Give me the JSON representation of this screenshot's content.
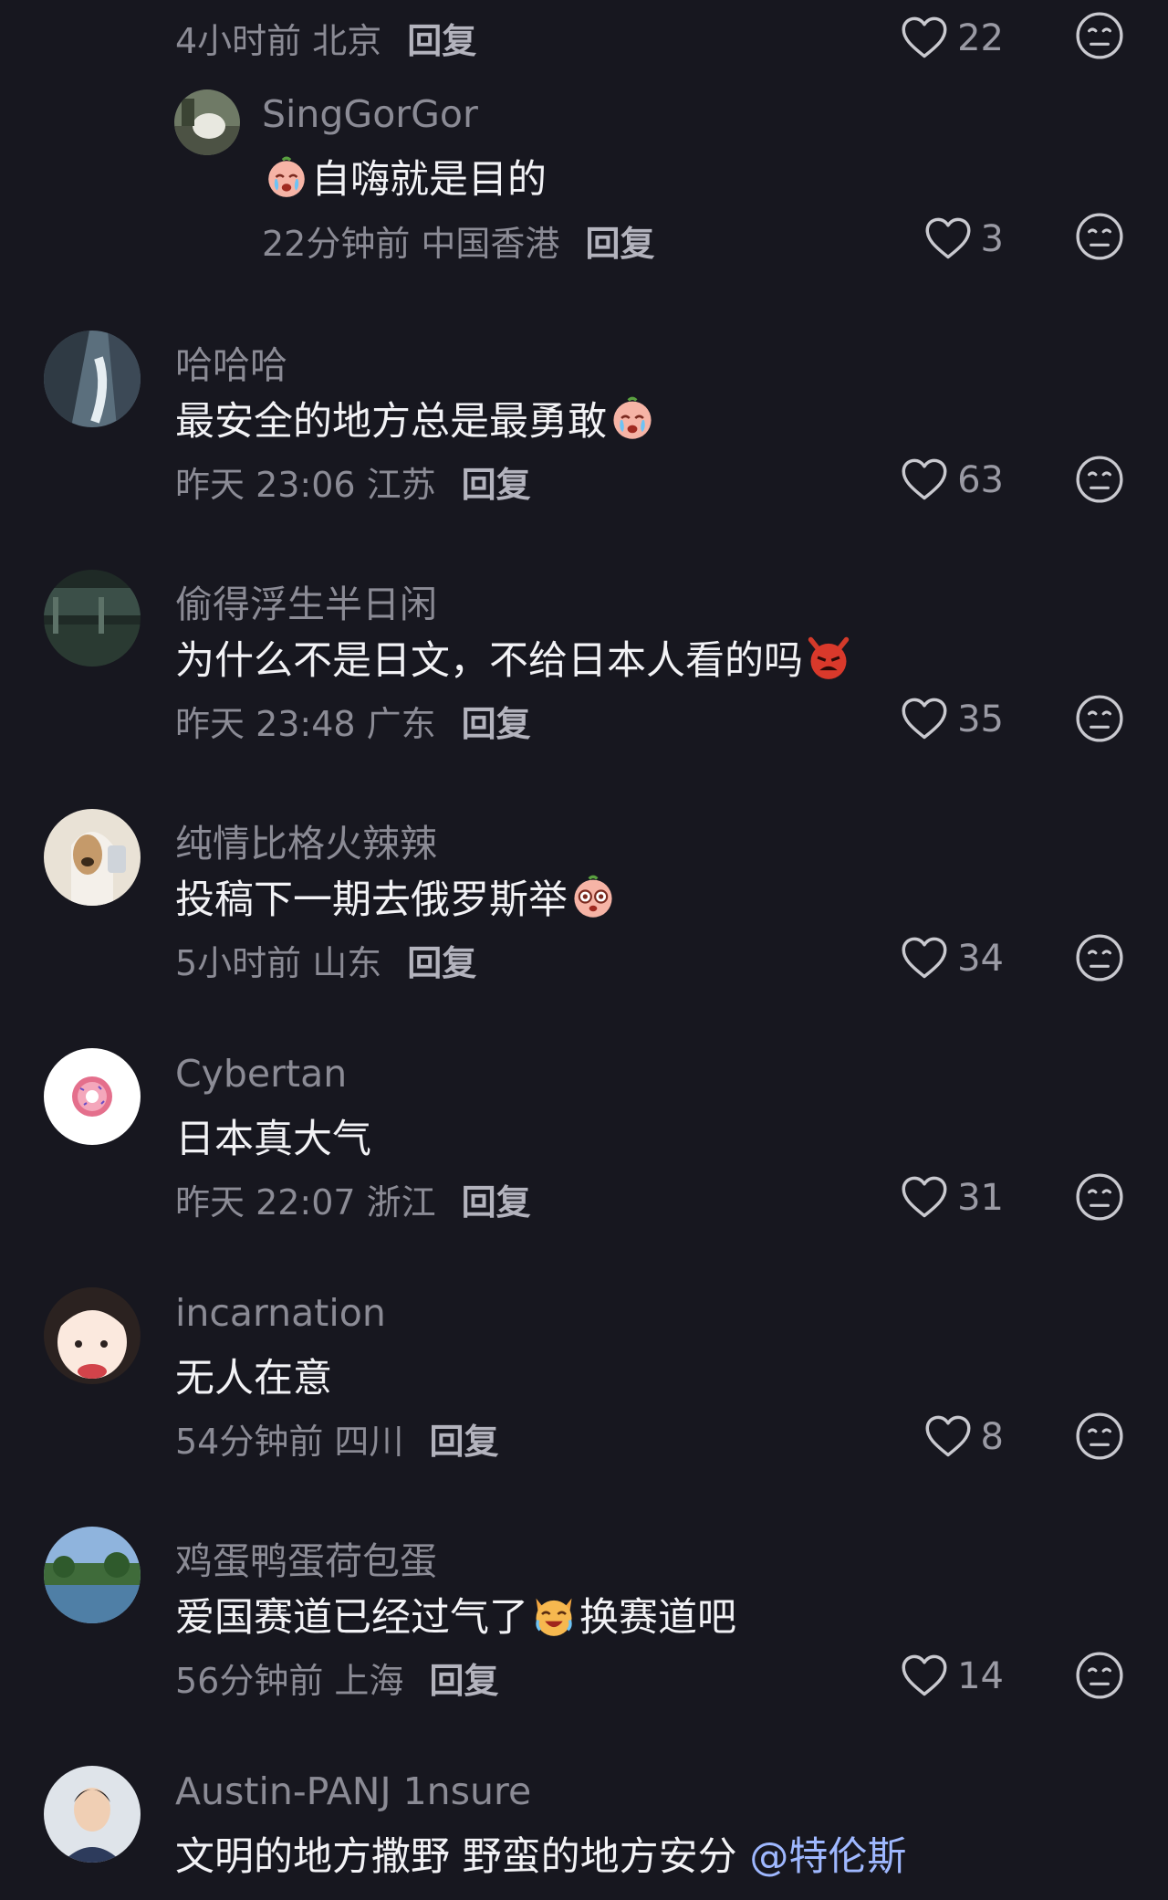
{
  "reply_label": "回复",
  "colors": {
    "background": "#17171f",
    "secondary_text": "#8b8b95",
    "primary_text": "#f2f2f5",
    "mention": "#9fb8ff"
  },
  "top_partial": {
    "meta": "4小时前 北京",
    "likes": "22"
  },
  "sub_reply": {
    "name": "SingGorGor",
    "text": "自嗨就是目的",
    "emoji": "crying-face",
    "meta": "22分钟前 中国香港",
    "likes": "3"
  },
  "comments": [
    {
      "name": "哈哈哈",
      "text": "最安全的地方总是最勇敢",
      "emoji": "crying-face",
      "meta": "昨天 23:06 江苏",
      "likes": "63"
    },
    {
      "name": "偷得浮生半日闲",
      "text": "为什么不是日文，不给日本人看的吗",
      "emoji": "angry-devil",
      "meta": "昨天 23:48 广东",
      "likes": "35"
    },
    {
      "name": "纯情比格火辣辣",
      "text": "投稿下一期去俄罗斯举",
      "emoji": "shocked-face",
      "meta": "5小时前 山东",
      "likes": "34"
    },
    {
      "name": "Cybertan",
      "text": "日本真大气",
      "meta": "昨天 22:07 浙江",
      "likes": "31"
    },
    {
      "name": "incarnation",
      "text": "无人在意",
      "meta": "54分钟前 四川",
      "likes": "8"
    },
    {
      "name": "鸡蛋鸭蛋荷包蛋",
      "text_before": "爱国赛道已经过气了",
      "text_after": "换赛道吧",
      "emoji": "laughing-cat",
      "meta": "56分钟前 上海",
      "likes": "14"
    },
    {
      "name": "Austin-PANJ 1nsure",
      "text": "文明的地方撒野 野蛮的地方安分",
      "mention": "@特伦斯"
    }
  ]
}
